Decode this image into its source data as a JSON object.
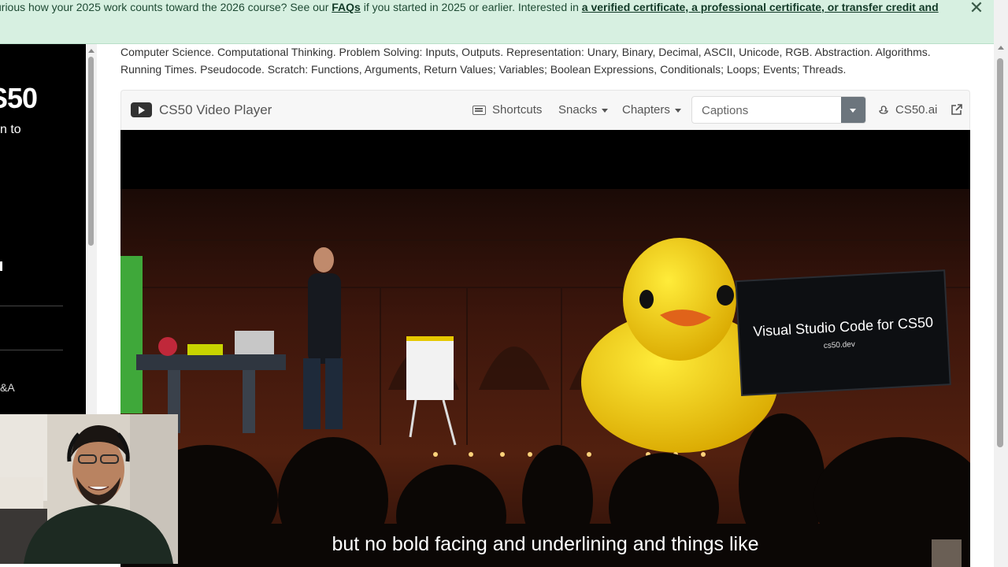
{
  "banner": {
    "text_before": "urious how your 2025 work counts toward the 2026 course? See our ",
    "faq_link": "FAQs",
    "text_middle": " if you started in 2025 or earlier. Interested in ",
    "cert_link": "a verified certificate, a professional certificate, or transfer credit and",
    "close_icon": "✕"
  },
  "sidebar": {
    "title": "S50",
    "subtitle": "n to",
    "qa_label": "&A"
  },
  "description": "Computer Science. Computational Thinking. Problem Solving: Inputs, Outputs. Representation: Unary, Binary, Decimal, ASCII, Unicode, RGB. Abstraction. Algorithms. Running Times. Pseudocode. Scratch: Functions, Arguments, Return Values; Variables; Boolean Expressions, Conditionals; Loops; Events; Threads.",
  "player": {
    "title": "CS50 Video Player",
    "shortcuts": "Shortcuts",
    "snacks": "Snacks",
    "chapters": "Chapters",
    "captions_selected": "Captions",
    "cs50ai": "CS50.ai",
    "icons": [
      "youtube-icon",
      "keyboard-icon",
      "duck-icon",
      "external-link-icon"
    ]
  },
  "video": {
    "screen_title": "Visual Studio Code for CS50",
    "screen_subtitle": "cs50.dev",
    "caption": "but no bold facing and underlining and things like"
  },
  "colors": {
    "banner_bg": "#d7f0e1",
    "sidebar_bg": "#000000",
    "caption_button": "#6c757d"
  }
}
